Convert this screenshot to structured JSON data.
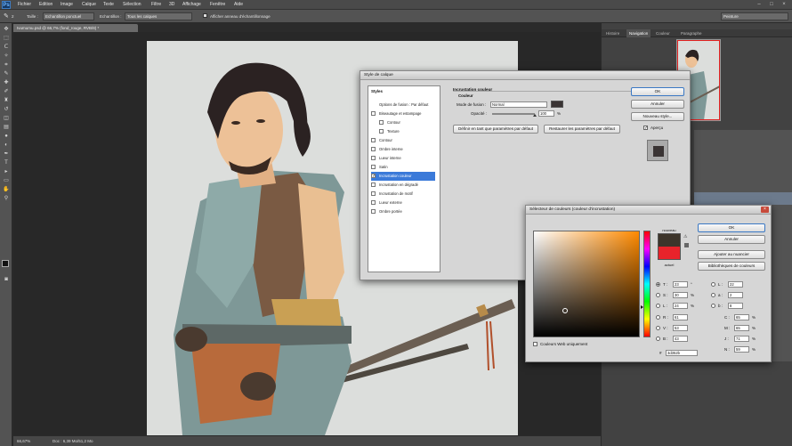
{
  "menubar": {
    "logo": "Ps",
    "items": [
      "Fichier",
      "Edition",
      "Image",
      "Calque",
      "Texte",
      "Sélection",
      "Filtre",
      "3D",
      "Affichage",
      "Fenêtre",
      "Aide"
    ]
  },
  "options": {
    "size": "2",
    "mode_label": "Taille :",
    "mode_value": "Echantillon ponctuel",
    "sample_label": "Echantillon :",
    "sample_value": "Tous les calques",
    "show_ring": "Afficher anneau d'échantillonnage",
    "workspace": "Peinture"
  },
  "document": {
    "tab": "Ivumumu.psd @ 66,7% (fond_rouge, RVB/8) *",
    "zoom": "66,67%",
    "doc_info": "Doc : 6,39 Mo/51,2 Mo"
  },
  "tools": [
    "move",
    "marquee",
    "lasso",
    "quick-select",
    "crop",
    "eyedropper",
    "healing",
    "brush",
    "stamp",
    "history-brush",
    "eraser",
    "gradient",
    "blur",
    "dodge",
    "pen",
    "text",
    "path-select",
    "shape",
    "hand",
    "zoom"
  ],
  "panel": {
    "tabs": [
      "Histoire",
      "Navigation",
      "Couleur",
      "Paragraphe"
    ],
    "active_tab": "Navigation"
  },
  "layer_style": {
    "title": "Style de calque",
    "styles_header": "Styles",
    "items": [
      {
        "label": "Options de fusion : Par défaut",
        "check": false,
        "sel": false
      },
      {
        "label": "Biseautage et estampage",
        "check": true,
        "sel": false
      },
      {
        "label": "Contour",
        "check": true,
        "sel": false
      },
      {
        "label": "Texture",
        "check": true,
        "sel": false
      },
      {
        "label": "Contour",
        "check": true,
        "sel": false
      },
      {
        "label": "Ombre interne",
        "check": true,
        "sel": false
      },
      {
        "label": "Lueur interne",
        "check": true,
        "sel": false
      },
      {
        "label": "Satin",
        "check": true,
        "sel": false
      },
      {
        "label": "Incrustation couleur",
        "check": true,
        "sel": true
      },
      {
        "label": "Incrustation en dégradé",
        "check": true,
        "sel": false
      },
      {
        "label": "Incrustation de motif",
        "check": true,
        "sel": false
      },
      {
        "label": "Lueur externe",
        "check": true,
        "sel": false
      },
      {
        "label": "Ombre portée",
        "check": true,
        "sel": false
      }
    ],
    "section_title": "Incrustation couleur",
    "subsection": "Couleur",
    "blend_label": "Mode de fusion :",
    "blend_value": "Normal",
    "opacity_label": "Opacité :",
    "opacity_value": "100",
    "opacity_unit": "%",
    "btn_set_default": "Définir en tant que paramètres par défaut",
    "btn_reset_default": "Restaurer les paramètres par défaut",
    "ok": "OK",
    "cancel": "Annuler",
    "new_style": "Nouveau style...",
    "preview": "Aperçu",
    "swatch_color": "#3a3434"
  },
  "color_picker": {
    "title": "Sélecteur de couleurs (couleur d'incrustation)",
    "ok": "OK",
    "cancel": "Annuler",
    "add_swatch": "Ajouter au nuancier",
    "libraries": "Bibliothèques de couleurs",
    "new_label": "nouveau",
    "current_label": "actuel",
    "web_only": "Couleurs Web uniquement",
    "hsb": [
      {
        "l": "T :",
        "v": "23",
        "u": "°"
      },
      {
        "l": "S :",
        "v": "30",
        "u": "%"
      },
      {
        "l": "L :",
        "v": "24",
        "u": "%"
      }
    ],
    "rgb": [
      {
        "l": "R :",
        "v": "61"
      },
      {
        "l": "V :",
        "v": "53"
      },
      {
        "l": "B :",
        "v": "43"
      }
    ],
    "lab": [
      {
        "l": "L :",
        "v": "22"
      },
      {
        "l": "a :",
        "v": "2"
      },
      {
        "l": "b :",
        "v": "8"
      }
    ],
    "cmyk": [
      {
        "l": "C :",
        "v": "65",
        "u": "%"
      },
      {
        "l": "M :",
        "v": "65",
        "u": "%"
      },
      {
        "l": "J :",
        "v": "71",
        "u": "%"
      },
      {
        "l": "N :",
        "v": "59",
        "u": "%"
      }
    ],
    "hex_label": "#",
    "hex_value": "3d352b",
    "new_color": "#3d352b",
    "current_color": "#e8232b"
  }
}
